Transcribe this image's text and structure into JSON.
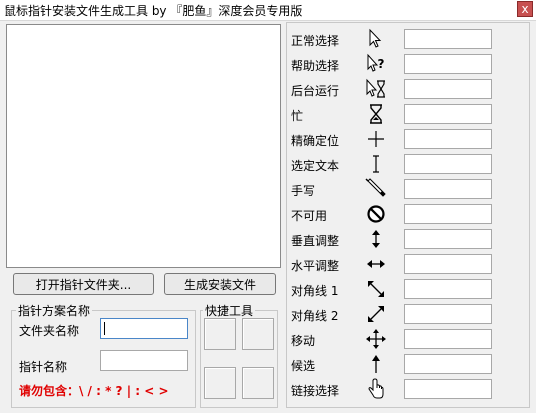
{
  "window": {
    "title": "鼠标指针安装文件生成工具  by 『肥鱼』深度会员专用版",
    "close_glyph": "x"
  },
  "buttons": {
    "open_folder": "打开指针文件夹...",
    "generate": "生成安装文件"
  },
  "scheme": {
    "group_label": "指针方案名称",
    "folder_name_label": "文件夹名称",
    "folder_name_value": "",
    "pointer_name_label": "指针名称",
    "pointer_name_value": "",
    "warning": "请勿包含：\\ / : * ? | : < >"
  },
  "shortcut": {
    "group_label": "快捷工具"
  },
  "cursor_rows": [
    {
      "label": "正常选择",
      "icon": "arrow-cursor-icon",
      "value": ""
    },
    {
      "label": "帮助选择",
      "icon": "help-cursor-icon",
      "value": ""
    },
    {
      "label": "后台运行",
      "icon": "working-cursor-icon",
      "value": ""
    },
    {
      "label": "忙",
      "icon": "hourglass-icon",
      "value": ""
    },
    {
      "label": "精确定位",
      "icon": "crosshair-icon",
      "value": ""
    },
    {
      "label": "选定文本",
      "icon": "text-ibeam-icon",
      "value": ""
    },
    {
      "label": "手写",
      "icon": "pen-icon",
      "value": ""
    },
    {
      "label": "不可用",
      "icon": "unavailable-icon",
      "value": ""
    },
    {
      "label": "垂直调整",
      "icon": "vertical-resize-icon",
      "value": ""
    },
    {
      "label": "水平调整",
      "icon": "horizontal-resize-icon",
      "value": ""
    },
    {
      "label": "对角线 1",
      "icon": "diagonal-resize-1-icon",
      "value": ""
    },
    {
      "label": "对角线 2",
      "icon": "diagonal-resize-2-icon",
      "value": ""
    },
    {
      "label": "移动",
      "icon": "move-icon",
      "value": ""
    },
    {
      "label": "候选",
      "icon": "alternate-select-icon",
      "value": ""
    },
    {
      "label": "链接选择",
      "icon": "hand-link-icon",
      "value": ""
    }
  ]
}
